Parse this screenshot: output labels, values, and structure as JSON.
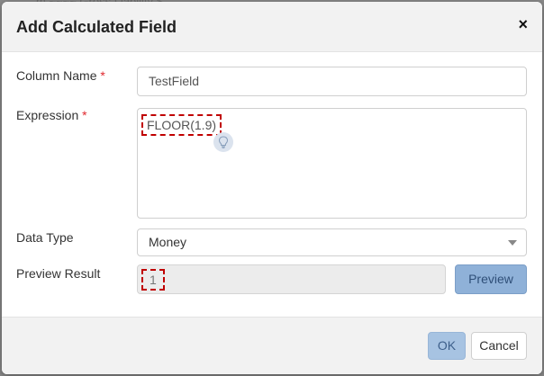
{
  "dialog": {
    "title": "Add Calculated Field",
    "close_glyph": "×"
  },
  "form": {
    "column_name_label": "Column Name",
    "required_mark": "*",
    "column_name_value": "TestField",
    "expression_label": "Expression",
    "expression_value": "FLOOR(1.9)",
    "data_type_label": "Data Type",
    "data_type_value": "Money",
    "preview_label": "Preview Result",
    "preview_value": "1",
    "preview_button": "Preview"
  },
  "footer": {
    "ok_label": "OK",
    "cancel_label": "Cancel"
  },
  "icons": {
    "bulb": "lightbulb-icon",
    "close": "close-icon",
    "caret": "chevron-down-icon"
  },
  "colors": {
    "required": "#e0282e",
    "highlight_dash": "#c00000",
    "primary_button": "#8fb1d8"
  }
}
